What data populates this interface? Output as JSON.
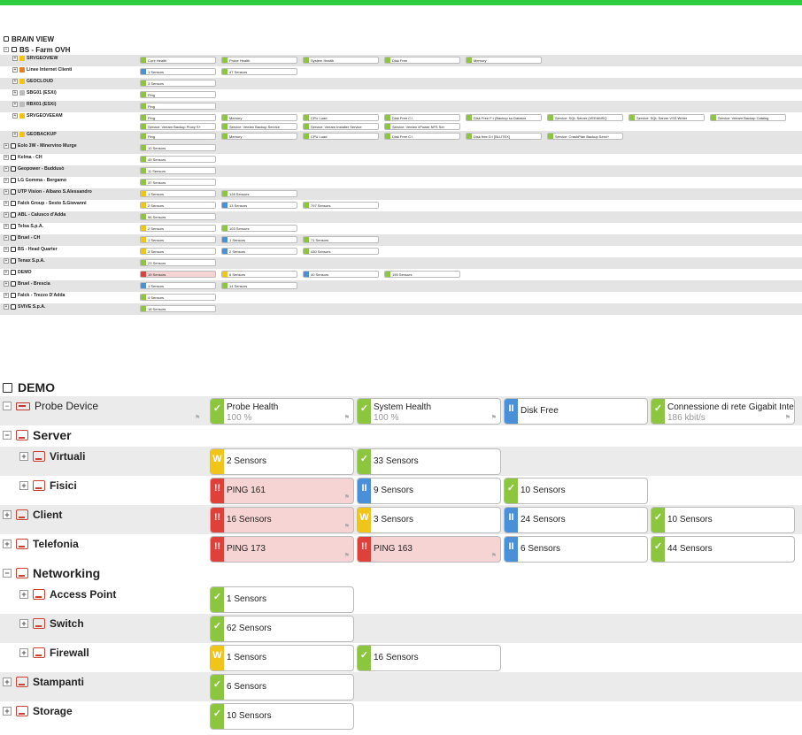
{
  "top": {
    "root_title": "BRAIN VIEW",
    "farm_title": "BS - Farm OVH",
    "rows": [
      {
        "name": "SRVGEOVIEW",
        "icon": "warn",
        "tall": false,
        "sensors": [
          [
            "g",
            "Core Health",
            "100 %"
          ],
          [
            "g",
            "Probe Health",
            "100 %"
          ],
          [
            "g",
            "System Health",
            "100 %"
          ],
          [
            "g",
            "Disk Free",
            "12 %"
          ],
          [
            "g",
            "Memory",
            "47 %"
          ]
        ]
      },
      {
        "name": "Linee Internet Clienti",
        "icon": "grp",
        "tall": false,
        "sensors": [
          [
            "b",
            "1 Sensors",
            ""
          ],
          [
            "g",
            "47 Sensors",
            ""
          ]
        ]
      },
      {
        "name": "GEOCLOUD",
        "icon": "warn",
        "tall": false,
        "sensors": [
          [
            "g",
            "3 Sensors",
            ""
          ]
        ]
      },
      {
        "name": "SBG01 (ESXi)",
        "icon": "srv",
        "tall": false,
        "sensors": [
          [
            "g",
            "Ping",
            "0 msec"
          ]
        ]
      },
      {
        "name": "RBX01 (ESXi)",
        "icon": "srv",
        "tall": false,
        "sensors": [
          [
            "g",
            "Ping",
            "11 msec"
          ]
        ]
      },
      {
        "name": "SRVGEOVEEAM",
        "icon": "warn",
        "tall": true,
        "sensors": [
          [
            "g",
            "Ping",
            "0 msec"
          ],
          [
            "g",
            "Memory",
            "46 %"
          ],
          [
            "g",
            "CPU Load",
            "0 %"
          ],
          [
            "g",
            "Disk Free C:\\",
            "28 %"
          ],
          [
            "g",
            "Disk Free F:\\ (Backup su Datasor",
            "23 %"
          ],
          [
            "g",
            "Service: SQL Server (VEEAMSQ",
            "33 msec"
          ],
          [
            "g",
            "Service: SQL Server VSS Writer",
            "38 msec"
          ],
          [
            "g",
            "Service: Veeam Backup Catalog",
            "34 msec"
          ],
          [
            "g",
            "Service: Veeam Backup Proxy S+",
            "37 msec"
          ],
          [
            "g",
            "Service: Veeam Backup Service",
            "38 msec"
          ],
          [
            "g",
            "Service: Veeam Installer Service",
            "36 msec"
          ],
          [
            "g",
            "Service: Veeam vPower NFS Ser",
            "35 msec"
          ]
        ]
      },
      {
        "name": "GEOBACKUP",
        "icon": "warn",
        "tall": false,
        "sensors": [
          [
            "g",
            "Ping",
            "0 msec"
          ],
          [
            "g",
            "Memory",
            "70 %"
          ],
          [
            "g",
            "CPU Load",
            "1 %"
          ],
          [
            "g",
            "Disk Free C:\\",
            "43 %"
          ],
          [
            "g",
            "Disk free D:\\ [BLUTEX]",
            "34 %"
          ],
          [
            "g",
            "Service: CrashPlan Backup Servi+",
            "35 msec"
          ]
        ]
      }
    ],
    "groups": [
      {
        "name": "Eolo 3W - Minervino Murge",
        "sensors": [
          [
            "g",
            "10 Sensors"
          ]
        ]
      },
      {
        "name": "Kelma - CH",
        "sensors": [
          [
            "g",
            "49 Sensors"
          ]
        ]
      },
      {
        "name": "Geopower - Buddusò",
        "sensors": [
          [
            "g",
            "11 Sensors"
          ]
        ]
      },
      {
        "name": "LG Gomma - Bergamo",
        "sensors": [
          [
            "g",
            "37 Sensors"
          ]
        ]
      },
      {
        "name": "UTP Vision - Albano S.Alessandro",
        "sensors": [
          [
            "y",
            "1 Sensors"
          ],
          [
            "g",
            "128 Sensors"
          ]
        ]
      },
      {
        "name": "Falck Group - Sesto S.Giovanni",
        "sensors": [
          [
            "y",
            "2 Sensors"
          ],
          [
            "b",
            "13 Sensors"
          ],
          [
            "g",
            "797 Sensors"
          ]
        ]
      },
      {
        "name": "ABL - Calusco d'Adda",
        "sensors": [
          [
            "g",
            "96 Sensors"
          ]
        ]
      },
      {
        "name": "Telsa S.p.A.",
        "sensors": [
          [
            "y",
            "2 Sensors"
          ],
          [
            "g",
            "103 Sensors"
          ]
        ]
      },
      {
        "name": "Bruel - CH",
        "sensors": [
          [
            "y",
            "1 Sensors"
          ],
          [
            "b",
            "1 Sensors"
          ],
          [
            "g",
            "71 Sensors"
          ]
        ]
      },
      {
        "name": "BS - Head Quarter",
        "sensors": [
          [
            "y",
            "3 Sensors"
          ],
          [
            "b",
            "2 Sensors"
          ],
          [
            "g",
            "430 Sensors"
          ]
        ]
      },
      {
        "name": "Tenax S.p.A.",
        "sensors": [
          [
            "g",
            "23 Sensors"
          ]
        ]
      },
      {
        "name": "DEMO",
        "sensors": [
          [
            "r",
            "19 Sensors"
          ],
          [
            "y",
            "6 Sensors"
          ],
          [
            "b",
            "40 Sensors"
          ],
          [
            "g",
            "195 Sensors"
          ]
        ]
      },
      {
        "name": "Bruel - Brescia",
        "sensors": [
          [
            "b",
            "1 Sensors"
          ],
          [
            "g",
            "14 Sensors"
          ]
        ]
      },
      {
        "name": "Falck - Trezzo D'Adda",
        "sensors": [
          [
            "g",
            "4 Sensors"
          ]
        ]
      },
      {
        "name": "SVIVE S.p.A.",
        "sensors": [
          [
            "g",
            "18 Sensors"
          ]
        ]
      }
    ]
  },
  "demo": {
    "title": "DEMO",
    "rows": [
      {
        "name": "Probe Device",
        "level": 0,
        "expand": "−",
        "icon": "probe",
        "bold": false,
        "big": false,
        "alt": true,
        "sensors": [
          [
            "g",
            "Probe Health",
            "100 %"
          ],
          [
            "g",
            "System Health",
            "100 %"
          ],
          [
            "b",
            "Disk Free",
            ""
          ],
          [
            "g",
            "Connessione di rete Gigabit Intel",
            "186 kbit/s"
          ]
        ]
      },
      {
        "name": "Server",
        "level": 0,
        "expand": "−",
        "icon": "grp",
        "bold": true,
        "big": true,
        "alt": false,
        "sensors": []
      },
      {
        "name": "Virtuali",
        "level": 1,
        "expand": "+",
        "icon": "grp",
        "bold": true,
        "big": false,
        "alt": true,
        "sensors": [
          [
            "y",
            "2 Sensors",
            ""
          ],
          [
            "g",
            "33 Sensors",
            ""
          ]
        ]
      },
      {
        "name": "Fisici",
        "level": 1,
        "expand": "+",
        "icon": "grp",
        "bold": true,
        "big": false,
        "alt": false,
        "sensors": [
          [
            "r",
            "PING 161",
            ""
          ],
          [
            "b",
            "9 Sensors",
            ""
          ],
          [
            "g",
            "10 Sensors",
            ""
          ]
        ]
      },
      {
        "name": "Client",
        "level": 0,
        "expand": "+",
        "icon": "grp",
        "bold": true,
        "big": false,
        "alt": true,
        "sensors": [
          [
            "r",
            "16 Sensors",
            ""
          ],
          [
            "y",
            "3 Sensors",
            ""
          ],
          [
            "b",
            "24 Sensors",
            ""
          ],
          [
            "g",
            "10 Sensors",
            ""
          ]
        ]
      },
      {
        "name": "Telefonia",
        "level": 0,
        "expand": "+",
        "icon": "grp",
        "bold": true,
        "big": false,
        "alt": false,
        "sensors": [
          [
            "r",
            "PING 173",
            ""
          ],
          [
            "r",
            "PING 163",
            ""
          ],
          [
            "b",
            "6 Sensors",
            ""
          ],
          [
            "g",
            "44 Sensors",
            ""
          ]
        ]
      },
      {
        "name": "Networking",
        "level": 0,
        "expand": "−",
        "icon": "grp",
        "bold": true,
        "big": true,
        "alt": false,
        "sensors": []
      },
      {
        "name": "Access Point",
        "level": 1,
        "expand": "+",
        "icon": "grp",
        "bold": true,
        "big": false,
        "alt": false,
        "sensors": [
          [
            "g",
            "1 Sensors",
            ""
          ]
        ]
      },
      {
        "name": "Switch",
        "level": 1,
        "expand": "+",
        "icon": "grp",
        "bold": true,
        "big": false,
        "alt": true,
        "sensors": [
          [
            "g",
            "62 Sensors",
            ""
          ]
        ]
      },
      {
        "name": "Firewall",
        "level": 1,
        "expand": "+",
        "icon": "grp",
        "bold": true,
        "big": false,
        "alt": false,
        "sensors": [
          [
            "y",
            "1 Sensors",
            ""
          ],
          [
            "g",
            "16 Sensors",
            ""
          ]
        ]
      },
      {
        "name": "Stampanti",
        "level": 0,
        "expand": "+",
        "icon": "grp",
        "bold": true,
        "big": false,
        "alt": true,
        "sensors": [
          [
            "g",
            "6 Sensors",
            ""
          ]
        ]
      },
      {
        "name": "Storage",
        "level": 0,
        "expand": "+",
        "icon": "grp",
        "bold": true,
        "big": false,
        "alt": false,
        "sensors": [
          [
            "g",
            "10 Sensors",
            ""
          ]
        ]
      }
    ]
  },
  "status_glyphs": {
    "g": "✓",
    "y": "W",
    "b": "II",
    "r": "!!"
  }
}
